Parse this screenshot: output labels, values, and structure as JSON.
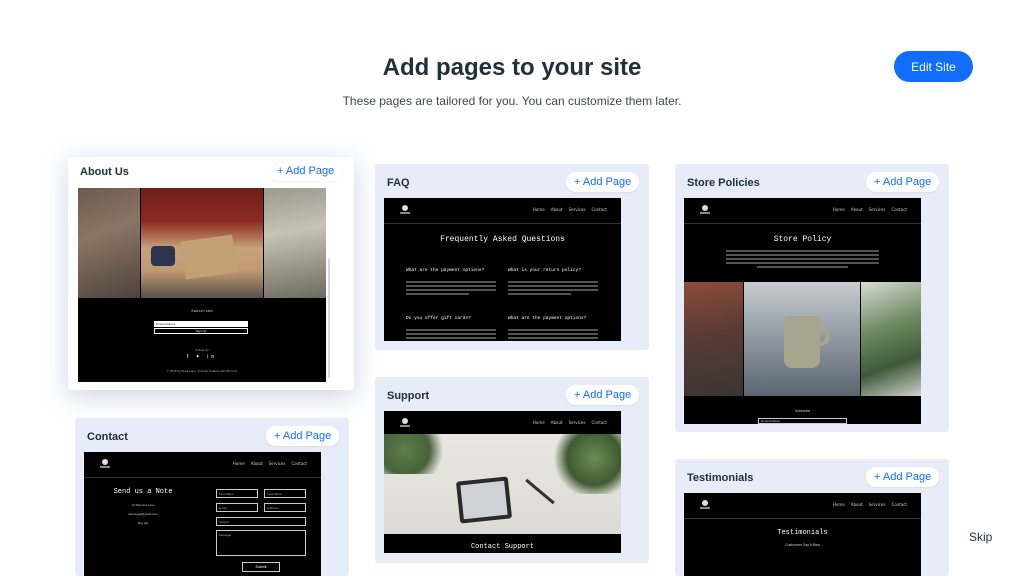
{
  "header": {
    "title": "Add pages to your site",
    "subtitle": "These pages are tailored for you. You can customize them later."
  },
  "edit_site_label": "Edit Site",
  "skip_label": "Skip",
  "add_page_label": "+ Add Page",
  "colors": {
    "accent": "#116dff",
    "card_bg": "#e8ecf8",
    "preview_bg": "#000000"
  },
  "nav_links": [
    "Home",
    "About",
    "Services",
    "Contact"
  ],
  "cards": {
    "about": {
      "title": "About Us",
      "subscribe": "Subscribe",
      "email_placeholder": "Email Address",
      "signup": "Sign Up",
      "follow": "Follow Us",
      "footer": "© 2035 by Book Farm. Proudly created with Wix.com"
    },
    "faq": {
      "title": "FAQ",
      "heading": "Frequently Asked Questions",
      "q1": "What are the payment options?",
      "q2": "What is your return policy?",
      "q3": "Do you offer gift cards?",
      "q4": "What are the payment options?"
    },
    "store": {
      "title": "Store Policies",
      "heading": "Store Policy",
      "subscribe": "Subscribe",
      "email_placeholder": "Email Address"
    },
    "contact": {
      "title": "Contact",
      "heading": "Send us a Note",
      "address": "12 Ramona Lane",
      "email": "alonsegal@gmail.com",
      "phone": "Buy gift",
      "fields": [
        "First Name",
        "Last Name",
        "Email",
        "Address",
        "Subject",
        "Message"
      ],
      "submit": "Submit"
    },
    "support": {
      "title": "Support",
      "heading": "Contact Support"
    },
    "testimonials": {
      "title": "Testimonials",
      "heading": "Testimonials",
      "sub": "Customers Say It Best"
    }
  }
}
